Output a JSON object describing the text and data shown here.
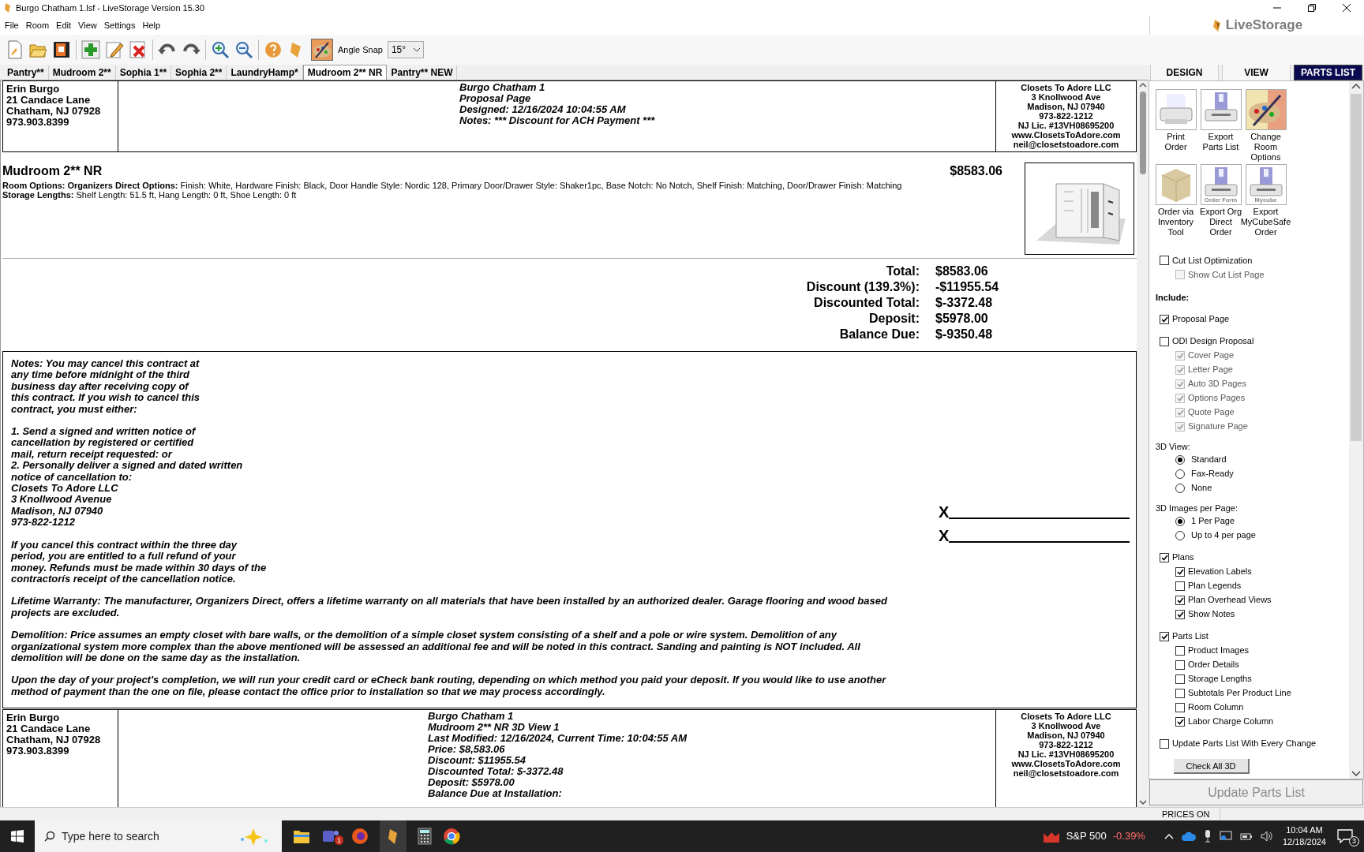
{
  "window": {
    "title": "Burgo Chatham 1.lsf - LiveStorage Version 15.30"
  },
  "menu": [
    "File",
    "Room",
    "Edit",
    "View",
    "Settings",
    "Help"
  ],
  "logo": "LiveStorage",
  "toolbar": {
    "angle_snap_label": "Angle Snap",
    "angle_snap_value": "15°"
  },
  "tabs": [
    {
      "label": "Pantry**",
      "selected": false
    },
    {
      "label": "Mudroom 2**",
      "selected": false
    },
    {
      "label": "Sophia 1**",
      "selected": false
    },
    {
      "label": "Sophia 2**",
      "selected": false
    },
    {
      "label": "LaundryHamp*",
      "selected": false
    },
    {
      "label": "Mudroom 2** NR",
      "selected": true
    },
    {
      "label": "Pantry** NEW",
      "selected": false
    }
  ],
  "document": {
    "header": {
      "customer": [
        "Erin Burgo",
        "21 Candace Lane",
        "Chatham, NJ 07928",
        "973.903.8399"
      ],
      "center": [
        "Burgo Chatham 1",
        "Proposal Page",
        "Designed: 12/16/2024 10:04:55 AM",
        "Notes: *** Discount for ACH Payment ***"
      ],
      "company": [
        "Closets To Adore LLC",
        "3 Knollwood Ave",
        "Madison, NJ 07940",
        "973-822-1212",
        "NJ Lic. #13VH08695200",
        "www.ClosetsToAdore.com",
        "neil@closetstoadore.com"
      ]
    },
    "room": {
      "name": "Mudroom 2** NR",
      "price": "$8583.06",
      "options": "**Room Options: Organizers Direct Options:** Finish: White, Hardware Finish: Black, Door Handle Style: Nordic 128, Primary Door/Drawer Style: Shaker1pc, Base Notch: No Notch, Shelf Finish: Matching, Door/Drawer Finish: Matching",
      "storage": "**Storage Lengths:**  Shelf Length: 51.5 ft, Hang Length: 0 ft, Shoe Length: 0 ft"
    },
    "totals": [
      {
        "label": "Total:",
        "value": "$8583.06"
      },
      {
        "label": "Discount (139.3%):",
        "value": "-$11955.54"
      },
      {
        "label": "Discounted Total:",
        "value": "$-3372.48"
      },
      {
        "label": "Deposit:",
        "value": "$5978.00"
      },
      {
        "label": "Balance Due:",
        "value": "$-9350.48"
      }
    ],
    "notes": [
      "Notes: You may cancel this contract at\nany time before midnight of the third\nbusiness day after receiving copy of\nthis contract. If you wish to cancel this\ncontract, you must either:",
      "1. Send a signed and written notice of\ncancellation by registered or certified\nmail, return receipt requested: or\n2. Personally deliver a signed and dated written\nnotice of cancellation to:\nClosets To Adore LLC\n3 Knollwood Avenue\nMadison, NJ 07940\n973-822-1212",
      "If you cancel this contract within the three day\nperiod, you are entitled to a full refund of your\nmoney. Refunds must be made within 30 days of the\ncontractorís receipt of the cancellation notice.",
      "Lifetime Warranty: The manufacturer, Organizers Direct, offers a lifetime warranty on all materials that have been installed by an authorized dealer. Garage flooring and wood based\nprojects are excluded.",
      "Demolition: Price assumes an empty closet with bare walls, or the demolition of a simple closet system consisting of a shelf and a pole or wire system. Demolition of any\norganizational system more complex than the above mentioned will be assessed an additional fee and will be noted in this contract. Sanding and painting is NOT included. All\ndemolition will be done on the same day as the installation.",
      "Upon the day of your project's completion, we will run your credit card or eCheck bank routing, depending on which method you paid your deposit. If you would like to use another\nmethod of payment than the one on file, please contact the office prior to installation so that we may process accordingly."
    ],
    "signatures": [
      "X",
      "X"
    ],
    "header2": {
      "customer": [
        "Erin Burgo",
        "21 Candace Lane",
        "Chatham, NJ 07928",
        "973.903.8399"
      ],
      "center": [
        "Burgo Chatham 1",
        "Mudroom 2** NR 3D View 1",
        "Last Modified: 12/16/2024, Current Time: 10:04:55 AM",
        "Price: $8,583.06",
        "Discount: $11955.54",
        "Discounted Total: $-3372.48",
        "Deposit: $5978.00",
        "Balance Due at Installation:"
      ],
      "company": [
        "Closets To Adore LLC",
        "3 Knollwood Ave",
        "Madison, NJ 07940",
        "973-822-1212",
        "NJ Lic. #13VH08695200",
        "www.ClosetsToAdore.com",
        "neil@closetstoadore.com"
      ]
    }
  },
  "panel": {
    "tabs": [
      {
        "label": "DESIGN",
        "selected": false
      },
      {
        "label": "VIEW",
        "selected": false
      },
      {
        "label": "PARTS LIST",
        "selected": true
      }
    ],
    "actions": [
      {
        "kind": "printer",
        "label": "Print\nOrder"
      },
      {
        "kind": "export",
        "label": "Export\nParts List"
      },
      {
        "kind": "palette",
        "label": "Change\nRoom\nOptions"
      },
      {
        "kind": "box",
        "label": "Order via\nInventory\nTool"
      },
      {
        "kind": "export",
        "label": "Export Org\nDirect Order",
        "caption": "Order Form"
      },
      {
        "kind": "export",
        "label": "Export\nMyCubeSafe\nOrder",
        "caption": "Mycube"
      }
    ],
    "options": [
      {
        "kind": "checkbox",
        "label": "Cut List Optimization",
        "checked": false,
        "disabled": false,
        "children": [
          {
            "kind": "checkbox",
            "label": "Show Cut List Page",
            "checked": false,
            "disabled": true
          }
        ]
      },
      {
        "kind": "heading",
        "label": "Include:"
      },
      {
        "kind": "checkbox",
        "label": "Proposal Page",
        "checked": true,
        "disabled": false
      },
      {
        "kind": "checkbox",
        "label": "ODI Design Proposal",
        "checked": false,
        "disabled": false,
        "children": [
          {
            "kind": "checkbox",
            "label": "Cover Page",
            "checked": true,
            "disabled": true
          },
          {
            "kind": "checkbox",
            "label": "Letter Page",
            "checked": true,
            "disabled": true
          },
          {
            "kind": "checkbox",
            "label": "Auto 3D Pages",
            "checked": true,
            "disabled": true
          },
          {
            "kind": "checkbox",
            "label": "Options Pages",
            "checked": true,
            "disabled": true
          },
          {
            "kind": "checkbox",
            "label": "Quote Page",
            "checked": true,
            "disabled": true
          },
          {
            "kind": "checkbox",
            "label": "Signature Page",
            "checked": true,
            "disabled": true
          }
        ]
      },
      {
        "kind": "group",
        "label": "3D View:",
        "children": [
          {
            "kind": "radio",
            "label": "Standard",
            "selected": true
          },
          {
            "kind": "radio",
            "label": "Fax-Ready",
            "selected": false
          },
          {
            "kind": "radio",
            "label": "None",
            "selected": false
          }
        ]
      },
      {
        "kind": "group",
        "label": "3D Images per Page:",
        "children": [
          {
            "kind": "radio",
            "label": "1 Per Page",
            "selected": true
          },
          {
            "kind": "radio",
            "label": "Up to 4 per page",
            "selected": false
          }
        ]
      },
      {
        "kind": "checkbox",
        "label": "Plans",
        "checked": true,
        "disabled": false,
        "children": [
          {
            "kind": "checkbox",
            "label": "Elevation Labels",
            "checked": true,
            "disabled": false
          },
          {
            "kind": "checkbox",
            "label": "Plan Legends",
            "checked": false,
            "disabled": false
          },
          {
            "kind": "checkbox",
            "label": "Plan Overhead Views",
            "checked": true,
            "disabled": false
          },
          {
            "kind": "checkbox",
            "label": "Show Notes",
            "checked": true,
            "disabled": false
          }
        ]
      },
      {
        "kind": "checkbox",
        "label": "Parts List",
        "checked": true,
        "disabled": false,
        "children": [
          {
            "kind": "checkbox",
            "label": "Product Images",
            "checked": false,
            "disabled": false
          },
          {
            "kind": "checkbox",
            "label": "Order Details",
            "checked": false,
            "disabled": false
          },
          {
            "kind": "checkbox",
            "label": "Storage Lengths",
            "checked": false,
            "disabled": false
          },
          {
            "kind": "checkbox",
            "label": "Subtotals Per Product Line",
            "checked": false,
            "disabled": false
          },
          {
            "kind": "checkbox",
            "label": "Room Column",
            "checked": false,
            "disabled": false
          },
          {
            "kind": "checkbox",
            "label": "Labor Charge Column",
            "checked": true,
            "disabled": false
          }
        ]
      },
      {
        "kind": "checkbox",
        "label": "Update Parts List With Every Change",
        "checked": false,
        "disabled": false
      }
    ],
    "check_all_button": "Check All 3D",
    "update_button": "Update Parts List"
  },
  "status_bar": [
    "PRICES ON"
  ],
  "taskbar": {
    "search_placeholder": "Type here to search",
    "teams_badge": "1",
    "stock_name": "S&P 500",
    "stock_change": "-0.39%",
    "time": "10:04 AM",
    "date": "12/18/2024",
    "notifications": "3"
  }
}
